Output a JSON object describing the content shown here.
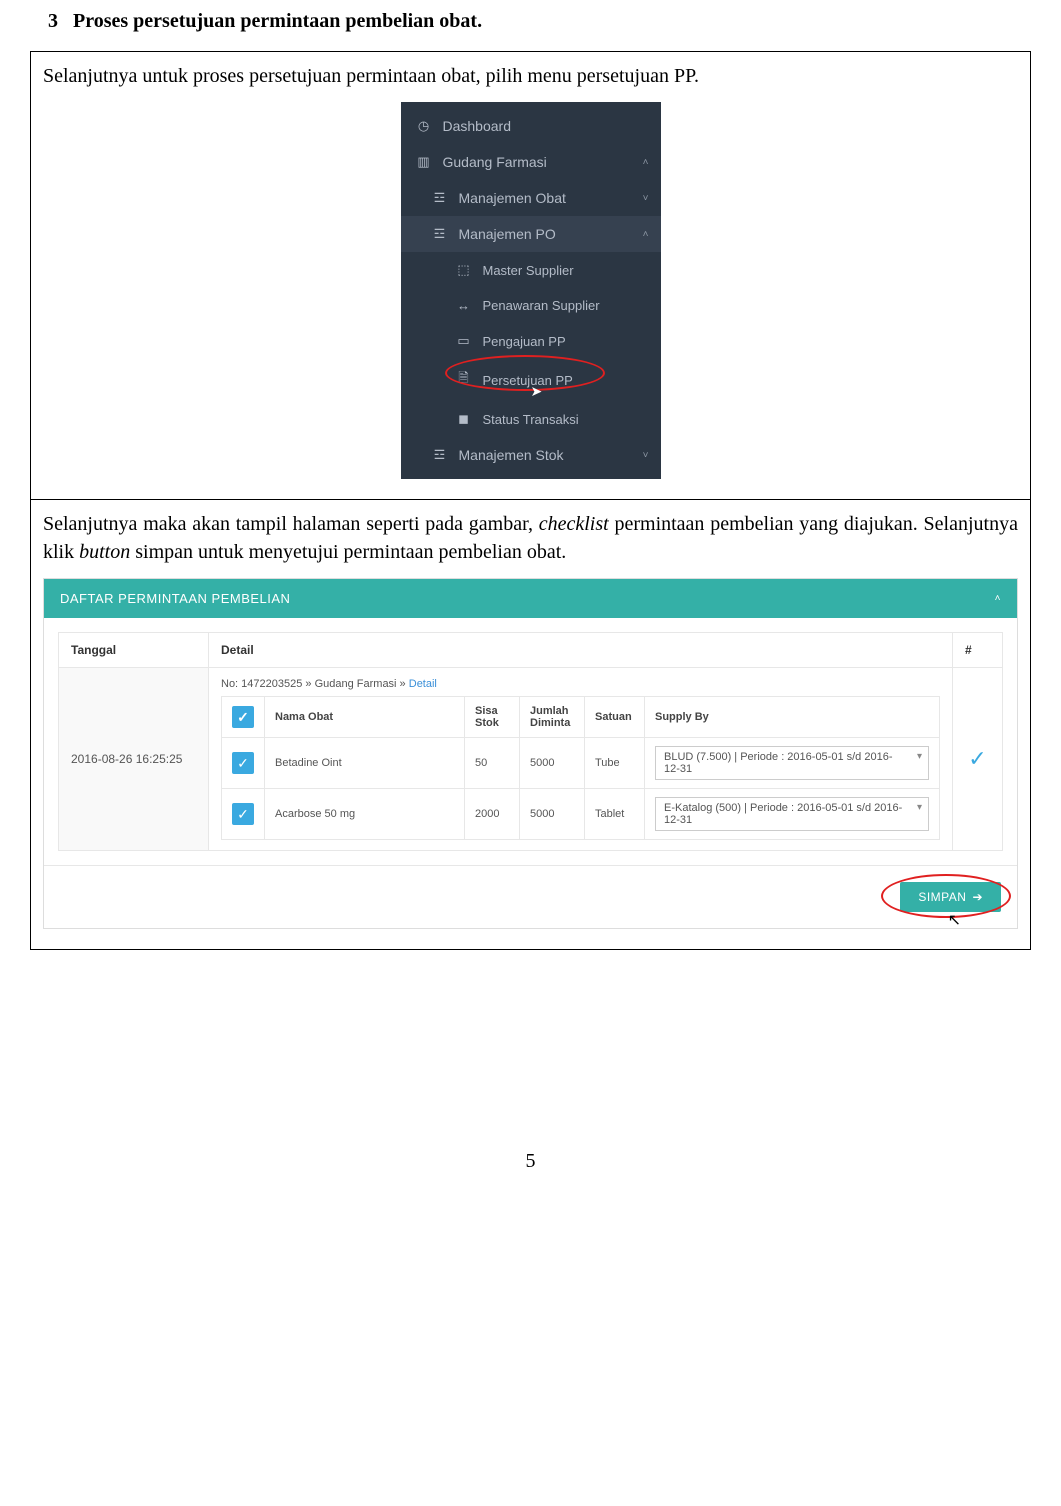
{
  "section": {
    "number": "3",
    "title": "Proses persetujuan permintaan pembelian obat."
  },
  "box1": {
    "text": "Selanjutnya untuk proses persetujuan permintaan obat, pilih menu persetujuan PP.",
    "sidebar": {
      "dashboard": "Dashboard",
      "gudang": "Gudang Farmasi",
      "mobat": "Manajemen Obat",
      "mpo": "Manajemen PO",
      "master": "Master Supplier",
      "penawaran": "Penawaran Supplier",
      "pengajuan": "Pengajuan PP",
      "persetujuan": "Persetujuan PP",
      "status": "Status Transaksi",
      "mstok": "Manajemen Stok"
    }
  },
  "box2": {
    "text_pre": "Selanjutnya maka akan tampil halaman seperti pada gambar, ",
    "text_italic1": "checklist",
    "text_mid": " permintaan pembelian yang diajukan. Selanjutnya klik ",
    "text_italic2": "button",
    "text_post": " simpan untuk menyetujui permintaan pembelian obat."
  },
  "panel": {
    "header": "DAFTAR PERMINTAAN PEMBELIAN",
    "columns": {
      "tanggal": "Tanggal",
      "detail": "Detail",
      "hash": "#"
    },
    "tanggal_value": "2016-08-26 16:25:25",
    "detail_prefix": "No: 1472203525 » Gudang Farmasi » ",
    "detail_link": "Detail",
    "inner_headers": {
      "nama": "Nama Obat",
      "sisa": "Sisa Stok",
      "jumlah": "Jumlah Diminta",
      "satuan": "Satuan",
      "supply": "Supply By"
    },
    "rows": [
      {
        "nama": "Betadine Oint",
        "sisa": "50",
        "jumlah": "5000",
        "satuan": "Tube",
        "supply": "BLUD (7.500) | Periode : 2016-05-01 s/d 2016-12-31"
      },
      {
        "nama": "Acarbose 50 mg",
        "sisa": "2000",
        "jumlah": "5000",
        "satuan": "Tablet",
        "supply": "E-Katalog (500) | Periode : 2016-05-01 s/d 2016-12-31"
      }
    ],
    "check_glyph": "✓",
    "simpan": "SIMPAN"
  },
  "page_number": "5"
}
